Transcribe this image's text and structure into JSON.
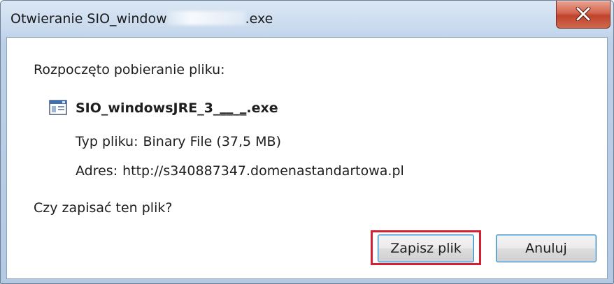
{
  "window": {
    "title_prefix": "Otwieranie SIO_window",
    "title_suffix": ".exe"
  },
  "dialog": {
    "heading": "Rozpoczęto pobieranie pliku:",
    "file_name": "SIO_windowsJRE_3_‗‗_‗.exe",
    "type_label": "Typ pliku:",
    "type_value": "Binary File (37,5 MB)",
    "address_label": "Adres:",
    "address_value": "http://s340887347.domenastandartowa.pl",
    "question": "Czy zapisać ten plik?"
  },
  "buttons": {
    "save_label": "Zapisz plik",
    "cancel_label": "Anuluj"
  },
  "icons": {
    "close": "close-icon",
    "file": "executable-file-icon"
  },
  "colors": {
    "highlight": "#d32032",
    "close_button": "#c7452e"
  }
}
